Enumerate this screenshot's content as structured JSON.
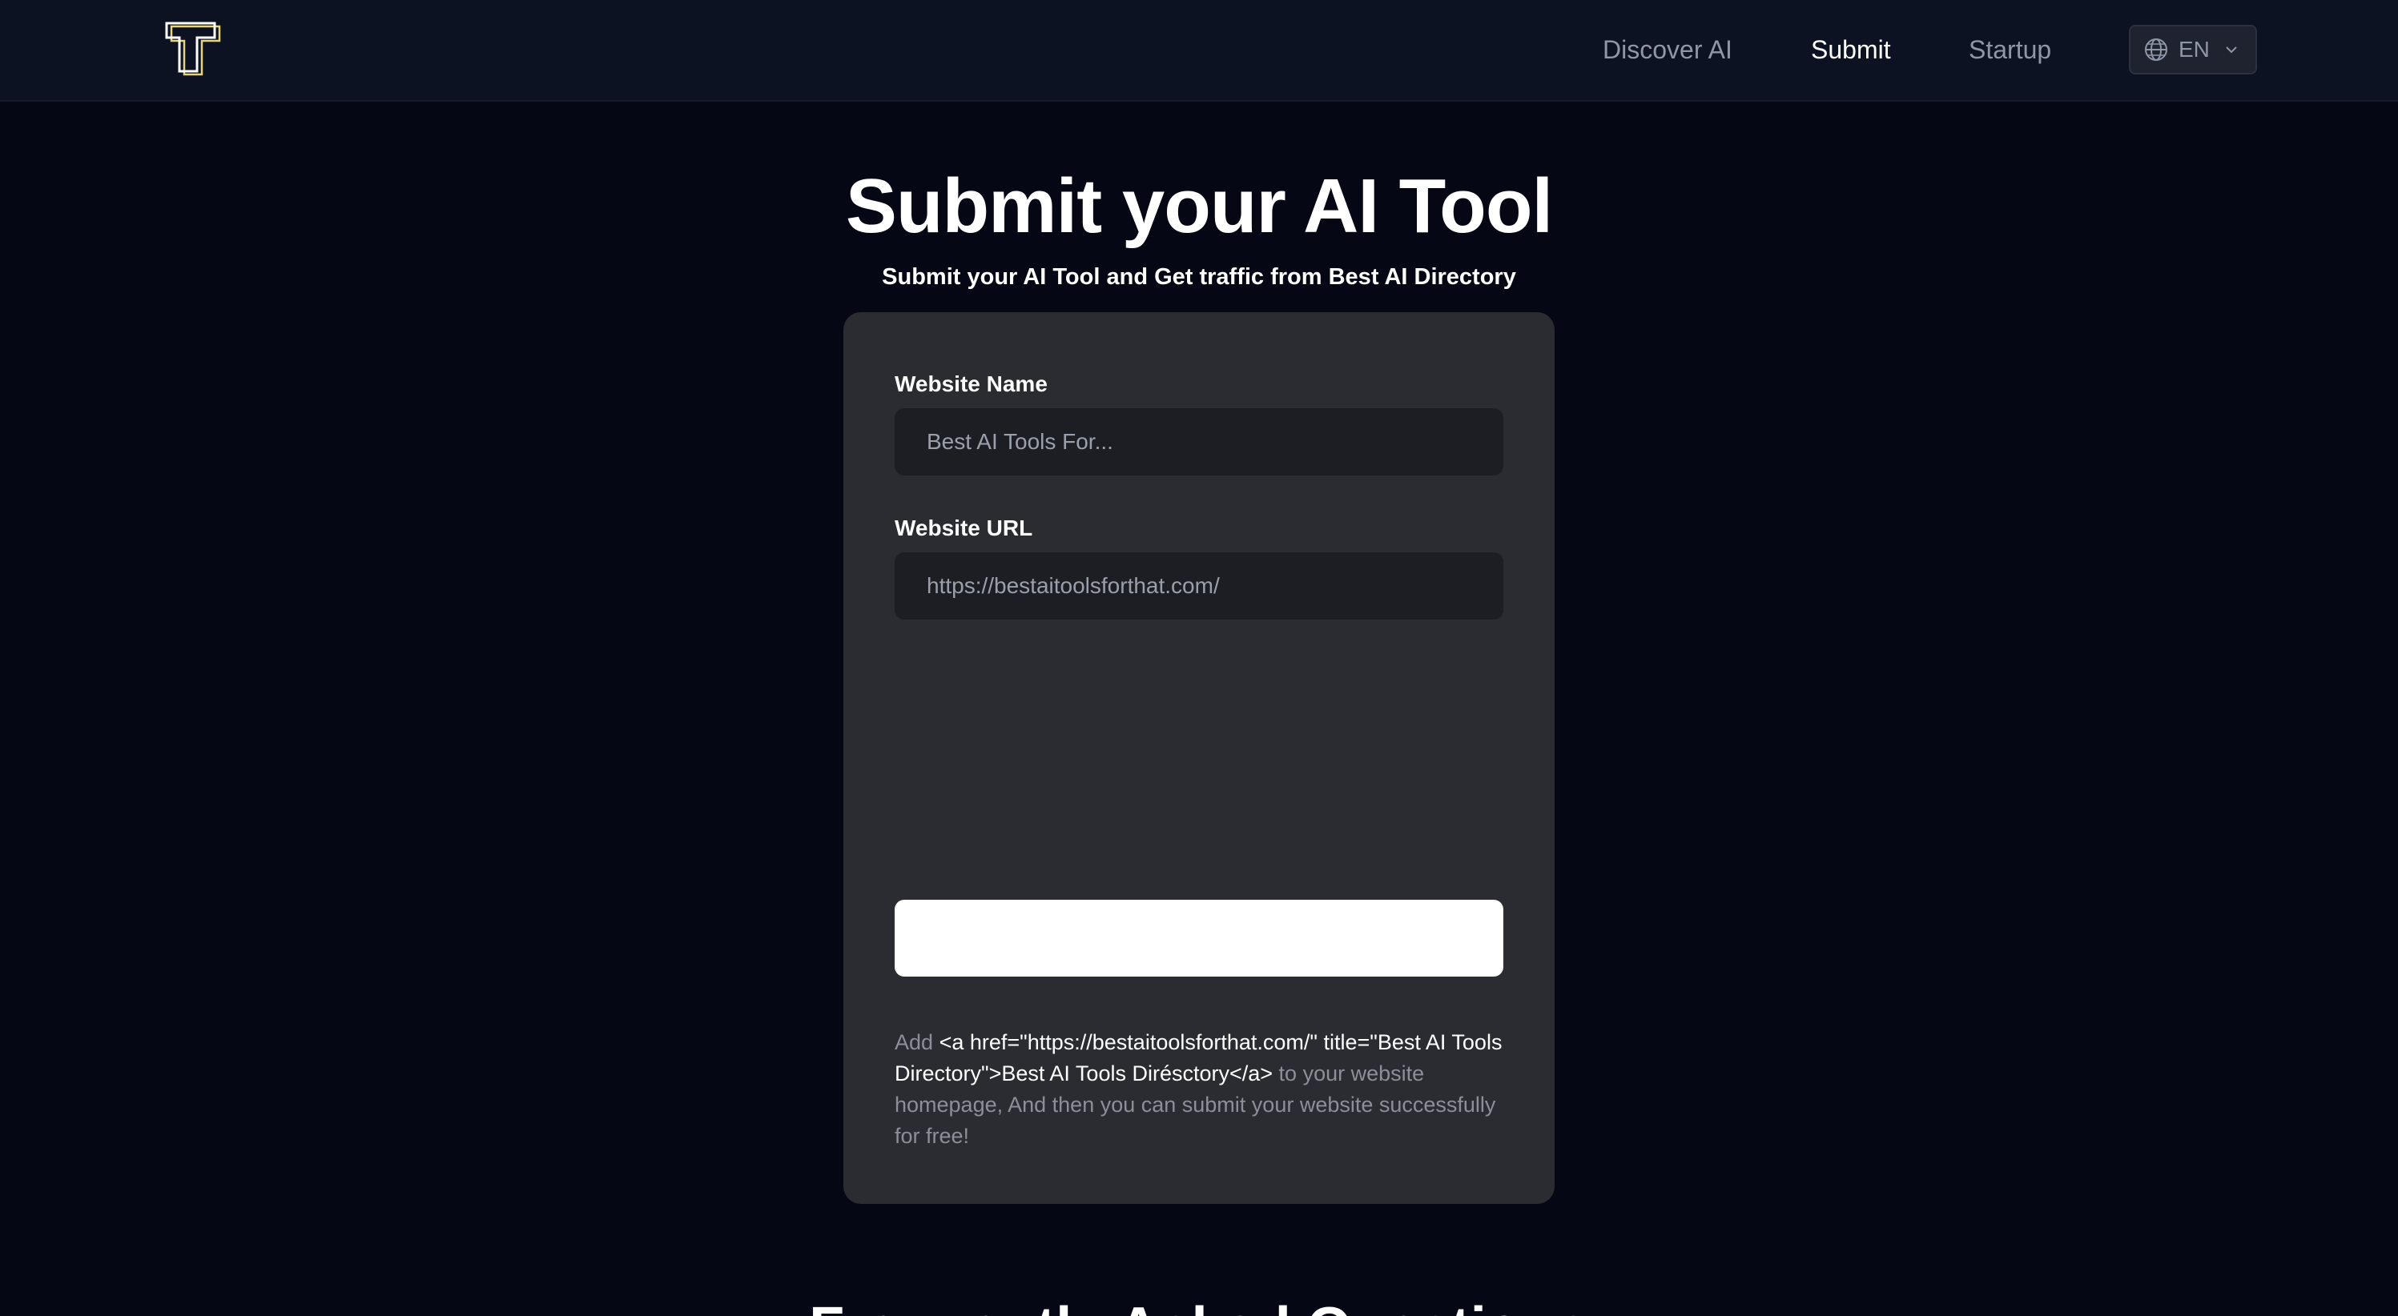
{
  "header": {
    "logo_icon": "t-letter-logo-icon",
    "nav": [
      {
        "label": "Discover AI",
        "active": false
      },
      {
        "label": "Submit",
        "active": true
      },
      {
        "label": "Startup",
        "active": false
      }
    ],
    "language": {
      "label": "EN",
      "icon": "globe-icon"
    }
  },
  "hero": {
    "title": "Submit your AI Tool",
    "subtitle": "Submit your AI Tool and Get traffic from Best AI Directory"
  },
  "form": {
    "name_label": "Website Name",
    "name_placeholder": "Best AI Tools For...",
    "url_label": "Website URL",
    "url_placeholder": "https://bestaitoolsforthat.com/",
    "submit_label": "",
    "note_prefix": "Add",
    "note_code": "<a href=\"https://bestaitoolsforthat.com/\" title=\"Best AI Tools Directory\">Best AI Tools Dirésctory</a>",
    "note_suffix": "to your website homepage, And then you can submit your website successfully for free!"
  },
  "faq": {
    "title": "Frequently Asked Questions"
  },
  "colors": {
    "page_bg": "#050814",
    "header_bg": "#0d1222",
    "card_bg": "#2b2c32",
    "input_bg": "#1d1e23",
    "muted_text": "#8c8f98"
  }
}
